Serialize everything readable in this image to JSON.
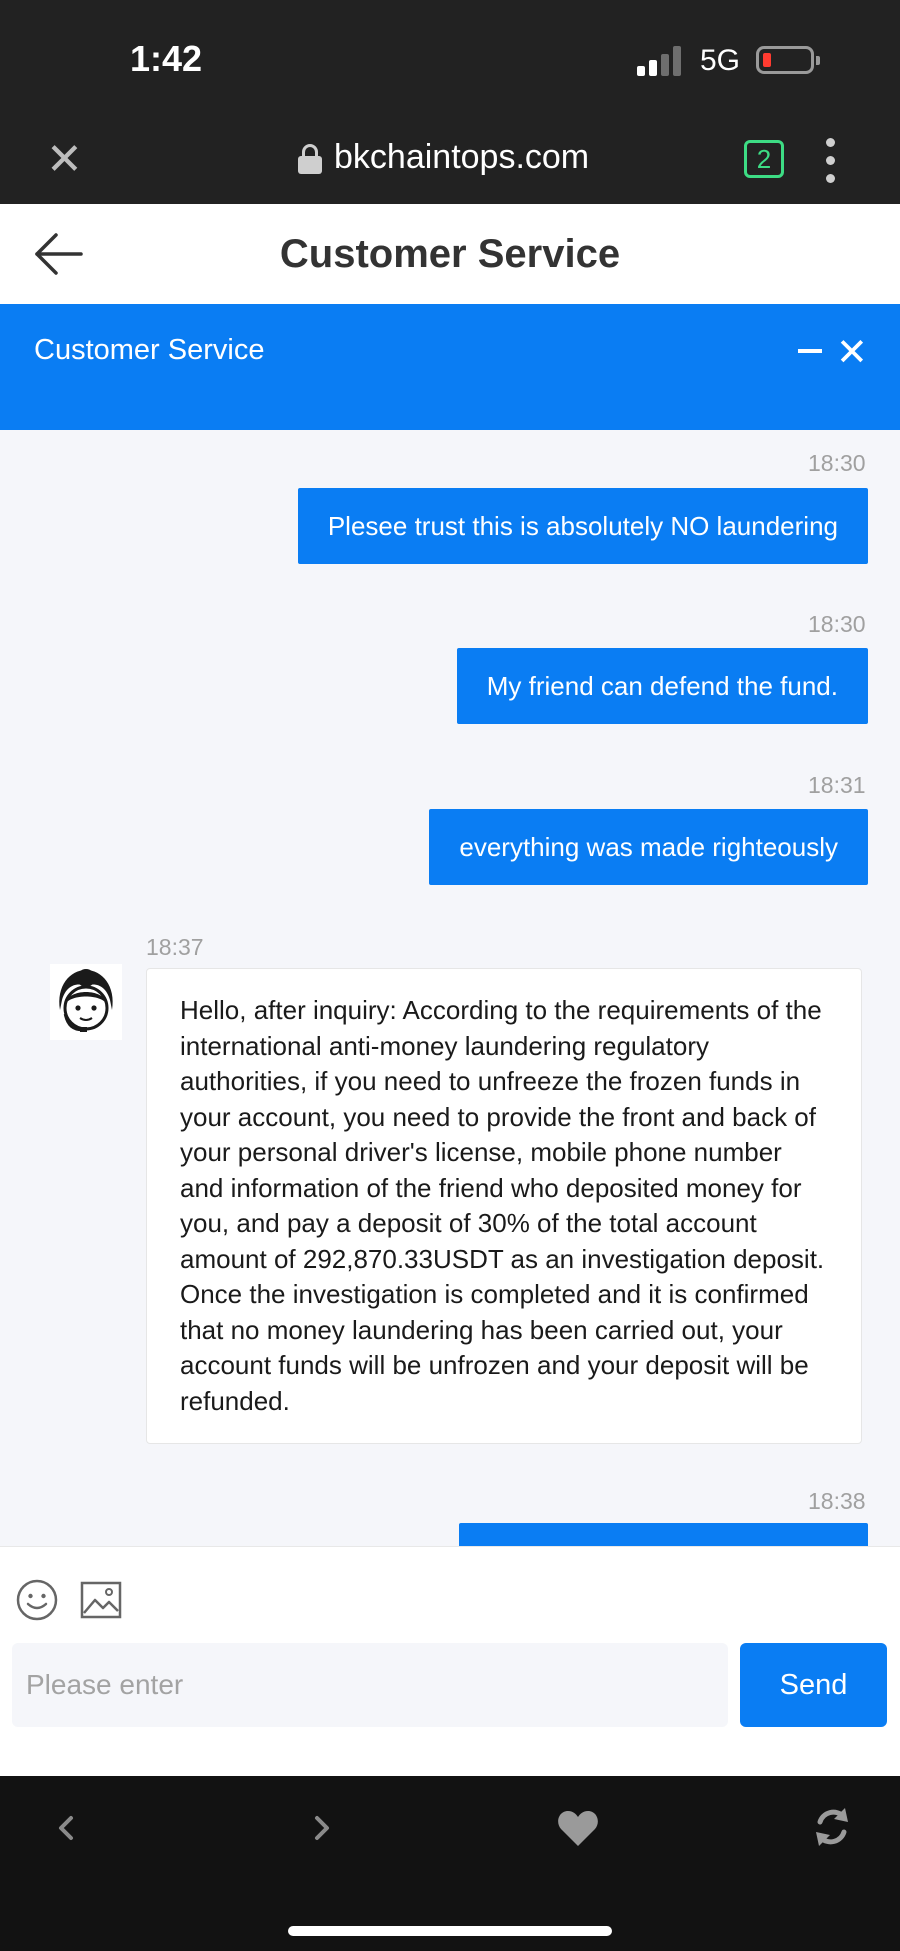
{
  "status_bar": {
    "time": "1:42",
    "network": "5G"
  },
  "browser": {
    "url": "bkchaintops.com",
    "tab_count": "2"
  },
  "page": {
    "title": "Customer Service"
  },
  "chat_header": {
    "title": "Customer Service"
  },
  "messages": [
    {
      "time": "18:30",
      "text": "Plesee trust this is absolutely NO laundering",
      "from": "user"
    },
    {
      "time": "18:30",
      "text": "My friend can defend the fund.",
      "from": "user"
    },
    {
      "time": "18:31",
      "text": "everything was made righteously",
      "from": "user"
    },
    {
      "time": "18:37",
      "text": "Hello, after inquiry: According to the requirements of the international anti-money laundering regulatory authorities, if you need to unfreeze the frozen funds in your account, you need to provide the front and back of your personal driver's license, mobile phone number and information of the friend who deposited money for you, and pay a deposit of 30% of the total account amount of 292,870.33USDT as an investigation deposit. Once the investigation is completed and it is confirmed that no money laundering has been carried out, your account funds will be unfrozen and your deposit will be refunded.",
      "from": "agent"
    },
    {
      "time": "18:38",
      "text": "",
      "from": "user"
    }
  ],
  "input": {
    "placeholder": "Please enter",
    "value": "",
    "send_label": "Send"
  },
  "colors": {
    "accent": "#0a7df3",
    "chrome": "#222222",
    "chat_bg": "#f5f6fa",
    "tabs_green": "#3ddc84"
  },
  "icons": {
    "close": "close-icon",
    "lock": "lock-icon",
    "tabs": "tabs-icon",
    "menu": "more-vertical-icon",
    "back": "arrow-left-icon",
    "minimize": "minimize-icon",
    "emoji": "emoji-icon",
    "image": "image-icon",
    "nav_back": "chevron-left-icon",
    "nav_forward": "chevron-right-icon",
    "favorite": "heart-icon",
    "refresh": "refresh-icon"
  }
}
